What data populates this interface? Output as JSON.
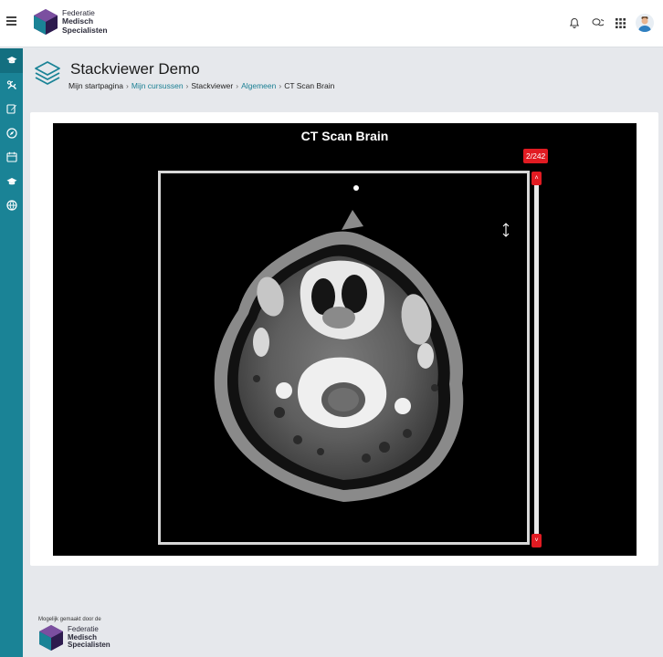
{
  "brand": {
    "line1": "Federatie",
    "line2": "Medisch",
    "line3": "Specialisten",
    "colors": {
      "purple": "#4a2a6e",
      "teal": "#1a8396",
      "accent_red": "#e11b22"
    }
  },
  "navbar": {
    "menu_icon": "hamburger-icon",
    "icons": [
      "bell-icon",
      "chat-icon",
      "apps-grid-icon",
      "user-avatar"
    ]
  },
  "sidebar": {
    "items": [
      {
        "icon": "graduation-cap-icon"
      },
      {
        "icon": "tools-icon"
      },
      {
        "icon": "edit-icon"
      },
      {
        "icon": "compass-icon"
      },
      {
        "icon": "calendar-icon"
      },
      {
        "icon": "graduation-cap-icon"
      },
      {
        "icon": "globe-icon"
      }
    ]
  },
  "page": {
    "title": "Stackviewer Demo",
    "breadcrumb": [
      "Mijn startpagina",
      "Mijn cursussen",
      "Stackviewer",
      "Algemeen",
      "CT Scan Brain"
    ]
  },
  "viewer": {
    "title": "CT Scan Brain",
    "slice_counter": "2/242",
    "current_slice": 2,
    "total_slices": 242
  },
  "footer": {
    "note": "Mogelijk gemaakt door de",
    "line1": "Federatie",
    "line2": "Medisch",
    "line3": "Specialisten"
  }
}
